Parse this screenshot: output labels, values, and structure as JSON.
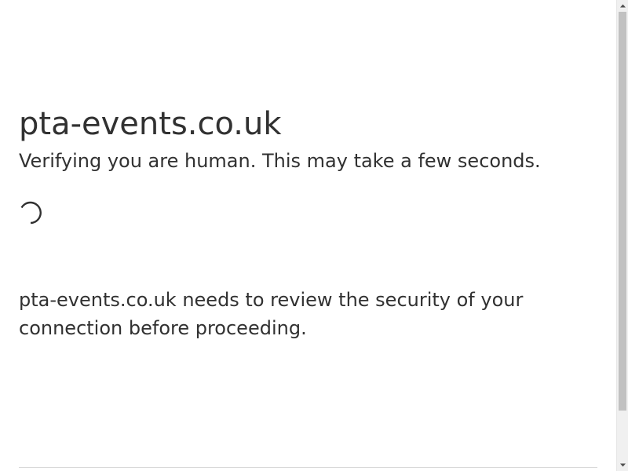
{
  "challenge": {
    "site_title": "pta-events.co.uk",
    "verifying_text": "Verifying you are human. This may take a few seconds.",
    "security_text": "pta-events.co.uk needs to review the security of your connection before proceeding.",
    "spinner_icon": "loading-spinner-icon"
  },
  "scrollbar": {
    "up_icon": "chevron-up-icon",
    "down_icon": "chevron-down-icon"
  },
  "colors": {
    "text": "#313131",
    "background": "#ffffff",
    "divider": "#d9d9d9",
    "scroll_thumb": "#c1c1c1"
  }
}
